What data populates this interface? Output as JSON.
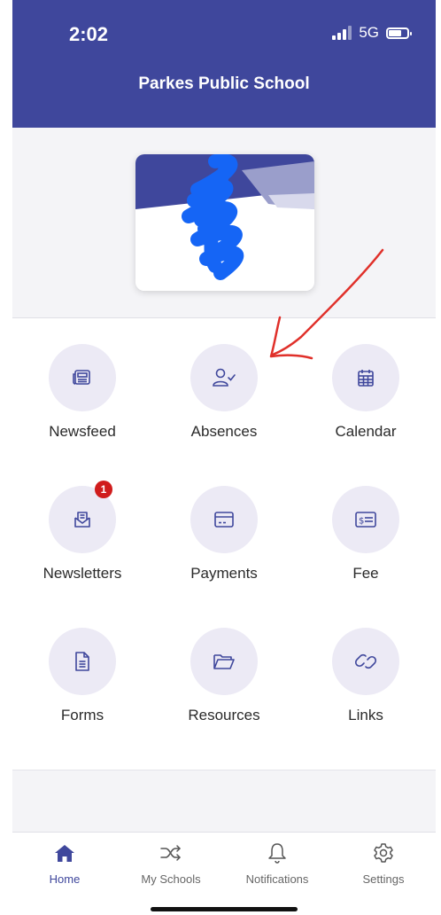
{
  "status_bar": {
    "time": "2:02",
    "network": "5G"
  },
  "header": {
    "title": "Parkes Public School",
    "background": "#3f479c"
  },
  "grid": {
    "items": [
      {
        "label": "Newsfeed",
        "icon": "newspaper-icon"
      },
      {
        "label": "Absences",
        "icon": "user-check-icon"
      },
      {
        "label": "Calendar",
        "icon": "calendar-icon"
      },
      {
        "label": "Newsletters",
        "icon": "mail-open-icon",
        "badge": "1"
      },
      {
        "label": "Payments",
        "icon": "credit-card-icon"
      },
      {
        "label": "Fee",
        "icon": "money-bill-icon"
      },
      {
        "label": "Forms",
        "icon": "document-icon"
      },
      {
        "label": "Resources",
        "icon": "folder-icon"
      },
      {
        "label": "Links",
        "icon": "link-icon"
      }
    ]
  },
  "tabbar": {
    "tabs": [
      {
        "label": "Home",
        "icon": "home-icon",
        "active": true
      },
      {
        "label": "My Schools",
        "icon": "shuffle-icon"
      },
      {
        "label": "Notifications",
        "icon": "bell-icon"
      },
      {
        "label": "Settings",
        "icon": "gear-icon"
      }
    ]
  },
  "colors": {
    "accent": "#3f479c",
    "tile_circle": "#eceaf5",
    "badge": "#d01c1c",
    "annotation_arrow": "#e0302a",
    "scribble": "#1565f5"
  }
}
